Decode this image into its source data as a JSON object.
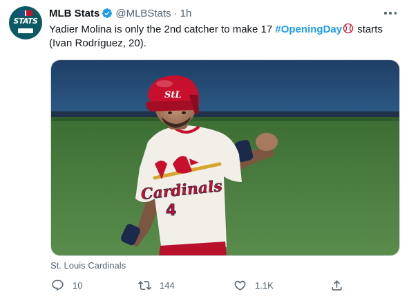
{
  "account": {
    "name": "MLB Stats",
    "handle": "@MLBStats",
    "separator": "·",
    "time": "1h",
    "avatar_text": "STATS"
  },
  "tweet": {
    "text_before": "Yadier Molina is only the 2nd catcher to make 17 ",
    "hashtag": "#OpeningDay",
    "text_after": " starts (Ivan Rodríguez, 20)."
  },
  "media": {
    "jersey_text": "Cardinals",
    "jersey_number": "4",
    "helmet_logo": "StL",
    "caption": "St. Louis Cardinals"
  },
  "actions": {
    "replies": "10",
    "retweets": "144",
    "likes": "1.1K"
  },
  "icons": {
    "verified": "verified-badge-icon",
    "more": "more-dots-icon",
    "reply": "reply-icon",
    "retweet": "retweet-icon",
    "like": "heart-icon",
    "share": "share-icon",
    "hashflag": "baseball-hashflag-icon"
  },
  "colors": {
    "accent": "#1d9bf0",
    "secondary_text": "#536471",
    "primary_text": "#0f1419",
    "uniform_red": "#c8102e"
  }
}
